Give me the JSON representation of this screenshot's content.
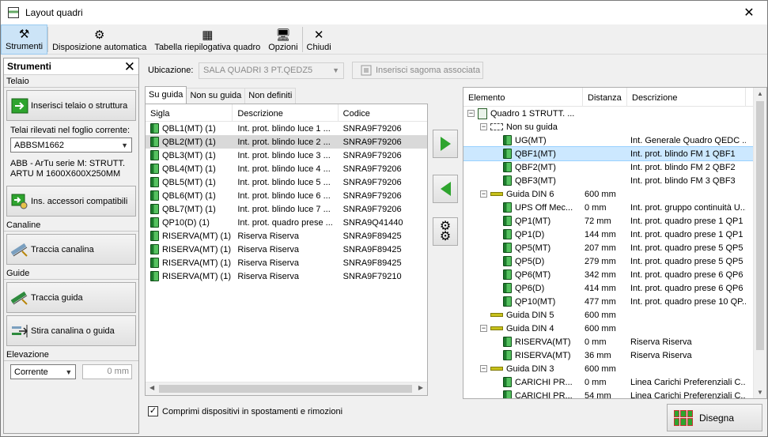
{
  "window": {
    "title": "Layout quadri",
    "close_glyph": "✕"
  },
  "toolbar": [
    {
      "label": "Strumenti",
      "icon": "tools-icon",
      "glyph": "⚒"
    },
    {
      "label": "Disposizione automatica",
      "icon": "gear-icon",
      "glyph": "⚙"
    },
    {
      "label": "Tabella riepilogativa quadro",
      "icon": "table-icon",
      "glyph": "▦"
    },
    {
      "label": "Opzioni",
      "icon": "options-icon",
      "glyph": "🖥"
    },
    {
      "label": "Chiudi",
      "icon": "close-icon",
      "glyph": "✕"
    }
  ],
  "tools": {
    "title": "Strumenti",
    "close_glyph": "✕",
    "telaio_label": "Telaio",
    "insert_frame_btn": "Inserisci telaio o struttura",
    "frames_label": "Telai rilevati nel foglio corrente:",
    "frames_selected": "ABBSM1662",
    "frame_desc": "ABB - ArTu serie M: STRUTT. ARTU M 1600X600X250MM",
    "accessories_btn": "Ins. accessori compatibili",
    "canalina_label": "Canaline",
    "trace_channel_btn": "Traccia canalina",
    "guide_label": "Guide",
    "trace_guide_btn": "Traccia guida",
    "stretch_btn": "Stira canalina o guida",
    "elev_label": "Elevazione",
    "elev_mode": "Corrente",
    "elev_value": "0 mm"
  },
  "location": {
    "label": "Ubicazione:",
    "value": "SALA QUADRI 3 PT.QEDZ5",
    "insert_shape_btn": "Inserisci sagoma associata"
  },
  "tabs": [
    "Su guida",
    "Non su guida",
    "Non definiti"
  ],
  "device_list": {
    "columns": [
      "Sigla",
      "Descrizione",
      "Codice"
    ],
    "rows": [
      {
        "sigla": "QBL1(MT) (1)",
        "desc": "Int. prot. blindo luce 1 ...",
        "code": "SNRA9F79206"
      },
      {
        "sigla": "QBL2(MT) (1)",
        "desc": "Int. prot. blindo luce 2 ...",
        "code": "SNRA9F79206"
      },
      {
        "sigla": "QBL3(MT) (1)",
        "desc": "Int. prot. blindo luce 3 ...",
        "code": "SNRA9F79206"
      },
      {
        "sigla": "QBL4(MT) (1)",
        "desc": "Int. prot. blindo luce 4 ...",
        "code": "SNRA9F79206"
      },
      {
        "sigla": "QBL5(MT) (1)",
        "desc": "Int. prot. blindo luce 5 ...",
        "code": "SNRA9F79206"
      },
      {
        "sigla": "QBL6(MT) (1)",
        "desc": "Int. prot. blindo luce 6 ...",
        "code": "SNRA9F79206"
      },
      {
        "sigla": "QBL7(MT) (1)",
        "desc": "Int. prot. blindo luce 7 ...",
        "code": "SNRA9F79206"
      },
      {
        "sigla": "QP10(D) (1)",
        "desc": "Int. prot. quadro prese ...",
        "code": "SNRA9Q41440"
      },
      {
        "sigla": "RISERVA(MT) (1)",
        "desc": "Riserva Riserva",
        "code": "SNRA9F89425"
      },
      {
        "sigla": "RISERVA(MT) (1)",
        "desc": "Riserva Riserva",
        "code": "SNRA9F89425"
      },
      {
        "sigla": "RISERVA(MT) (1)",
        "desc": "Riserva Riserva",
        "code": "SNRA9F89425"
      },
      {
        "sigla": "RISERVA(MT) (1)",
        "desc": "Riserva Riserva",
        "code": "SNRA9F79210"
      }
    ]
  },
  "tree": {
    "columns": [
      "Elemento",
      "Distanza",
      "Descrizione"
    ],
    "rows": [
      {
        "level": 0,
        "exp": "−",
        "kind": "board",
        "name": "Quadro 1 STRUTT. ...",
        "dist": "",
        "desc": ""
      },
      {
        "level": 1,
        "exp": "−",
        "kind": "group",
        "name": "Non su guida",
        "dist": "",
        "desc": ""
      },
      {
        "level": 2,
        "exp": "",
        "kind": "device",
        "name": "UG(MT)",
        "dist": "",
        "desc": "Int. Generale Quadro QEDC ..."
      },
      {
        "level": 2,
        "exp": "",
        "kind": "device",
        "name": "QBF1(MT)",
        "dist": "",
        "desc": "Int. prot. blindo FM 1 QBF1"
      },
      {
        "level": 2,
        "exp": "",
        "kind": "device",
        "name": "QBF2(MT)",
        "dist": "",
        "desc": "Int. prot. blindo FM 2 QBF2"
      },
      {
        "level": 2,
        "exp": "",
        "kind": "device",
        "name": "QBF3(MT)",
        "dist": "",
        "desc": "Int. prot. blindo FM 3 QBF3"
      },
      {
        "level": 1,
        "exp": "−",
        "kind": "guide",
        "name": "Guida DIN 6",
        "dist": "600 mm",
        "desc": ""
      },
      {
        "level": 2,
        "exp": "",
        "kind": "device",
        "name": "UPS Off Mec...",
        "dist": "0 mm",
        "desc": "Int. prot. gruppo continuità U..."
      },
      {
        "level": 2,
        "exp": "",
        "kind": "device",
        "name": "QP1(MT)",
        "dist": "72 mm",
        "desc": "Int. prot. quadro prese 1 QP1"
      },
      {
        "level": 2,
        "exp": "",
        "kind": "device",
        "name": "QP1(D)",
        "dist": "144 mm",
        "desc": "Int. prot. quadro prese 1 QP1"
      },
      {
        "level": 2,
        "exp": "",
        "kind": "device",
        "name": "QP5(MT)",
        "dist": "207 mm",
        "desc": "Int. prot. quadro prese 5 QP5"
      },
      {
        "level": 2,
        "exp": "",
        "kind": "device",
        "name": "QP5(D)",
        "dist": "279 mm",
        "desc": "Int. prot. quadro prese 5 QP5"
      },
      {
        "level": 2,
        "exp": "",
        "kind": "device",
        "name": "QP6(MT)",
        "dist": "342 mm",
        "desc": "Int. prot. quadro prese 6 QP6"
      },
      {
        "level": 2,
        "exp": "",
        "kind": "device",
        "name": "QP6(D)",
        "dist": "414 mm",
        "desc": "Int. prot. quadro prese 6 QP6"
      },
      {
        "level": 2,
        "exp": "",
        "kind": "device",
        "name": "QP10(MT)",
        "dist": "477 mm",
        "desc": "Int. prot. quadro prese 10 QP..."
      },
      {
        "level": 1,
        "exp": "",
        "kind": "guide",
        "name": "Guida DIN 5",
        "dist": "600 mm",
        "desc": ""
      },
      {
        "level": 1,
        "exp": "−",
        "kind": "guide",
        "name": "Guida DIN 4",
        "dist": "600 mm",
        "desc": ""
      },
      {
        "level": 2,
        "exp": "",
        "kind": "device",
        "name": "RISERVA(MT)",
        "dist": "0 mm",
        "desc": "Riserva Riserva"
      },
      {
        "level": 2,
        "exp": "",
        "kind": "device",
        "name": "RISERVA(MT)",
        "dist": "36 mm",
        "desc": "Riserva Riserva"
      },
      {
        "level": 1,
        "exp": "−",
        "kind": "guide",
        "name": "Guida DIN 3",
        "dist": "600 mm",
        "desc": ""
      },
      {
        "level": 2,
        "exp": "",
        "kind": "device",
        "name": "CARICHI PR...",
        "dist": "0 mm",
        "desc": "Linea Carichi Preferenziali C..."
      },
      {
        "level": 2,
        "exp": "",
        "kind": "device",
        "name": "CARICHI PR...",
        "dist": "54 mm",
        "desc": "Linea Carichi Preferenziali C..."
      }
    ]
  },
  "compress_checkbox": {
    "label": "Comprimi dispositivi in spostamenti e rimozioni",
    "checked": "✓"
  },
  "draw_btn": "Disegna"
}
